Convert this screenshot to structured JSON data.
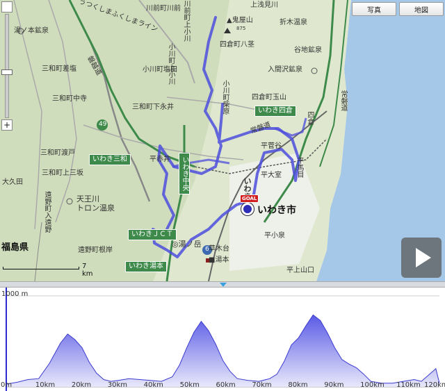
{
  "toolbar": {
    "photo_label": "写真",
    "map_label": "地図"
  },
  "zoom": {
    "plus": "+",
    "minus": "−"
  },
  "scale": {
    "label": "7 km"
  },
  "map_labels": {
    "top_road": "うつくしまふくしまライン",
    "kawamae_upper": "川前町上小川",
    "kawamae_lower": "川前町川前",
    "kamiasami": "上浅見川",
    "oninokuyama": "▲鬼屋山",
    "oninokuyama_alt": "875",
    "orikisawa": "折木温泉",
    "yunohongozan": "湯ノ本鉱泉",
    "miwamachi_minobu": "三和町差塩",
    "miwamachi_nakatera": "三和町中寺",
    "miwamachi_shimonagai": "三和町下永井",
    "ogawamachi_shiota": "小川町塩田",
    "ogawamachi_kamiogawa": "小川町上小川",
    "yotsukuramachi_yatsugi": "四倉町八茎",
    "yotsukuramachi_tamayama": "四倉町玉山",
    "yotsukura": "四倉",
    "tanichikouzen": "谷地鉱泉",
    "irimazawa": "入間沢鉱泉",
    "miwamachi_watarido": "三和町渡戸",
    "miwamachi_kamiharai": "三和町上三坂",
    "ogawamachi_takahagi": "小川町柴原",
    "hirakubo": "平菅谷",
    "hirasaka": "平赤井",
    "hiraumada": "平馬目",
    "hira": "平",
    "taira_ondo": "平大室",
    "okubota": "大久田",
    "toonomachi": "遠野町入遠野",
    "tennoukawa": "天王川\nトロン温泉",
    "fukushima": "福島県",
    "toonomachi_negiya": "遠野町根岸",
    "yumoto": "■湯本",
    "kusakidai": "草木台",
    "taira_kosen": "平小泉",
    "taira_kamiyamaguchi": "平上山口",
    "iwaki_city": "いわき市",
    "iwaki_city_prefix": "いわき",
    "yunotake": "◎湯ノ岳",
    "route_49": "49",
    "route_6": "6",
    "route_right": "常磐道",
    "route_tohoku": "常磐道",
    "route_highway": "磐越道",
    "route_ban": "常磐線",
    "aokami": "芳木",
    "shimotaka": "下高"
  },
  "badges": {
    "iwaki_yotsukura": "いわき四倉",
    "iwaki_miwa": "いわき三和",
    "iwaki_jct": "いわきＪＣＴ",
    "iwaki_yumoto": "いわき湯本",
    "iwaki_chuo": "いわき中央"
  },
  "goal": {
    "label": "GOAL"
  },
  "profile": {
    "max_label": "1000 m",
    "x_ticks": [
      "0m",
      "10km",
      "20km",
      "30km",
      "40km",
      "50km",
      "60km",
      "70km",
      "80km",
      "90km",
      "100km",
      "110km",
      "120km"
    ]
  },
  "chart_data": {
    "type": "area",
    "title": "",
    "xlabel": "",
    "ylabel": "",
    "xlim": [
      0,
      120
    ],
    "ylim": [
      0,
      1000
    ],
    "x": [
      0,
      3,
      6,
      9,
      12,
      15,
      17,
      19,
      21,
      23,
      25,
      27,
      29,
      31,
      34,
      37,
      40,
      43,
      46,
      48,
      50,
      52,
      54,
      56,
      58,
      60,
      62,
      64,
      67,
      70,
      73,
      75,
      77,
      79,
      81,
      83,
      85,
      87,
      89,
      91,
      93,
      95,
      97,
      99,
      101,
      104,
      107,
      110,
      113,
      115,
      117,
      119,
      120
    ],
    "values": [
      30,
      50,
      80,
      90,
      260,
      480,
      580,
      520,
      430,
      270,
      150,
      80,
      60,
      70,
      90,
      80,
      70,
      60,
      110,
      240,
      430,
      600,
      720,
      620,
      470,
      290,
      170,
      90,
      70,
      60,
      90,
      140,
      280,
      460,
      540,
      670,
      790,
      730,
      590,
      430,
      300,
      250,
      210,
      140,
      60,
      40,
      40,
      60,
      80,
      60,
      130,
      200,
      40
    ],
    "series": [
      {
        "values": []
      }
    ]
  }
}
